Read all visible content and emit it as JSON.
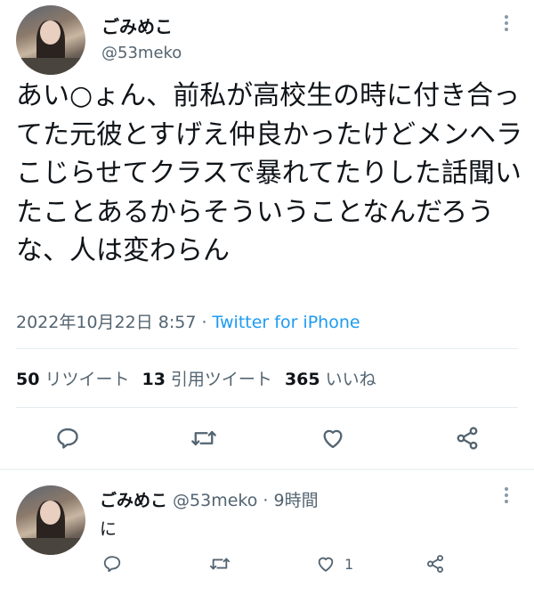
{
  "tweet": {
    "display_name": "ごみめこ",
    "handle": "@53meko",
    "text": "あい○ょん、前私が高校生の時に付き合ってた元彼とすげえ仲良かったけどメンヘラこじらせてクラスで暴れてたりした話聞いたことあるからそういうことなんだろうな、人は変わらん",
    "timestamp": "2022年10月22日 8:57",
    "separator": " · ",
    "source": "Twitter for iPhone",
    "stats": {
      "retweets_count": "50",
      "retweets_label": "リツイート",
      "quotes_count": "13",
      "quotes_label": "引用ツイート",
      "likes_count": "365",
      "likes_label": "いいね"
    },
    "actions": [
      "reply-icon",
      "retweet-icon",
      "heart-icon",
      "share-icon"
    ]
  },
  "reply": {
    "display_name": "ごみめこ",
    "meta": " @53meko · 9時間",
    "text": "に",
    "like_count": "1",
    "actions": [
      "reply-icon",
      "retweet-icon",
      "heart-icon",
      "share-icon"
    ]
  },
  "colors": {
    "text_primary": "#0f1419",
    "text_secondary": "#536471",
    "link": "#1d9bf0",
    "divider": "#e6ecf0"
  }
}
